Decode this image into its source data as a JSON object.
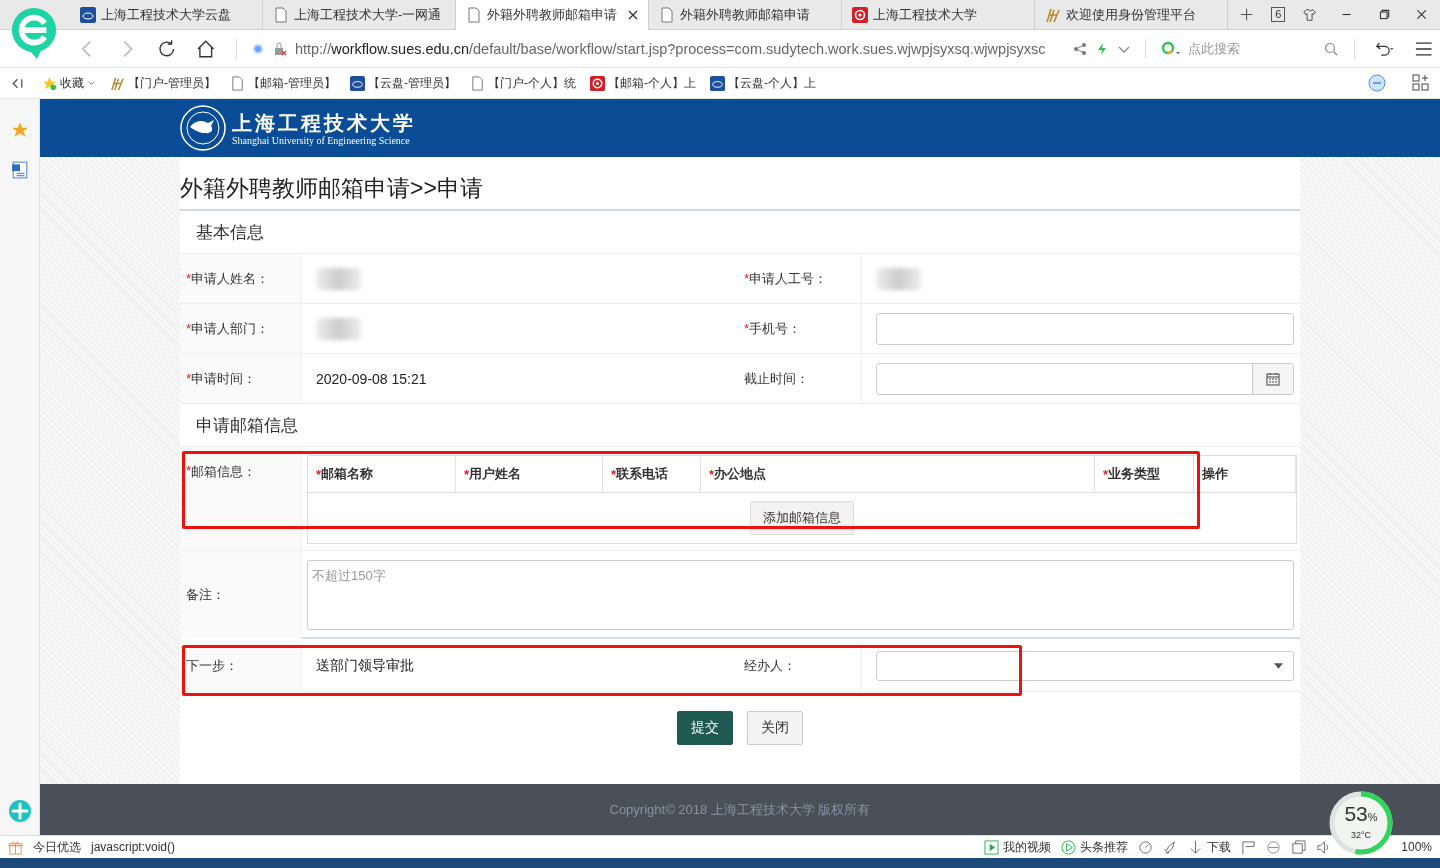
{
  "browser": {
    "tabs": [
      {
        "title": "上海工程技术大学云盘",
        "kind": "cloud",
        "selected": false
      },
      {
        "title": "上海工程技术大学-一网通",
        "kind": "page",
        "selected": false
      },
      {
        "title": "外籍外聘教师邮箱申请",
        "kind": "page",
        "selected": true
      },
      {
        "title": "外籍外聘教师邮箱申请",
        "kind": "page",
        "selected": false
      },
      {
        "title": "上海工程技术大学",
        "kind": "mail",
        "selected": false
      },
      {
        "title": "欢迎使用身份管理平台",
        "kind": "deer",
        "selected": false
      }
    ],
    "tab_count": "6",
    "url": {
      "scheme": "http://",
      "host": "workflow.sues.edu.cn",
      "path": "/default/base/workflow/start.jsp?process=com.sudytech.work.sues.wjwpjsyxsq.wjwpjsyxsc"
    },
    "search_placeholder": "点此搜索",
    "favorites": "收藏",
    "bookmarks": [
      {
        "label": "【门户-管理员】",
        "kind": "deer"
      },
      {
        "label": "【邮箱-管理员】",
        "kind": "page"
      },
      {
        "label": "【云盘-管理员】",
        "kind": "cloud"
      },
      {
        "label": "【门户-个人】统",
        "kind": "page"
      },
      {
        "label": "【邮箱-个人】上",
        "kind": "mail"
      },
      {
        "label": "【云盘-个人】上",
        "kind": "cloud"
      }
    ]
  },
  "page": {
    "logo": {
      "cn": "上海工程技术大学",
      "en": "Shanghai University of Engineering Science"
    },
    "title": "外籍外聘教师邮箱申请>>申请",
    "basic_section": "基本信息",
    "rows": [
      [
        {
          "mark": "*",
          "label": "申请人姓名：",
          "kind": "redacted"
        },
        {
          "mark": "*",
          "label": "申请人工号：",
          "kind": "redacted"
        }
      ],
      [
        {
          "mark": "*",
          "label": "申请人部门：",
          "kind": "redacted"
        },
        {
          "mark": "*",
          "label": "手机号：",
          "kind": "input"
        }
      ],
      [
        {
          "mark": "*",
          "label": "申请时间：",
          "kind": "text",
          "value": "2020-09-08 15:21"
        },
        {
          "label": "截止时间：",
          "kind": "date"
        }
      ]
    ],
    "mail_section": "申请邮箱信息",
    "mail": {
      "mark": "*",
      "label": "邮箱信息：",
      "highlighted": true,
      "columns": [
        {
          "mark": "*",
          "label": "邮箱名称"
        },
        {
          "mark": "*",
          "label": "用户姓名"
        },
        {
          "mark": "*",
          "label": "联系电话"
        },
        {
          "mark": "*",
          "label": "办公地点"
        },
        {
          "mark": "*",
          "label": "业务类型"
        },
        {
          "label": "操作"
        }
      ],
      "add_button": "添加邮箱信息"
    },
    "remarks": {
      "label": "备注：",
      "placeholder": "不超过150字"
    },
    "next": {
      "label": "下一步：",
      "value": "送部门领导审批",
      "handler_label": "经办人：",
      "highlighted": true
    },
    "buttons": [
      {
        "label": "提交",
        "kind": "primary"
      },
      {
        "label": "关闭",
        "kind": "default"
      }
    ],
    "footer": "Copyright© 2018 上海工程技术大学 版权所有"
  },
  "status_bar": {
    "left": [
      "今日优选",
      "javascript:void()"
    ],
    "video": "我的视频",
    "news": "头条推荐",
    "download": "下载",
    "zoom": "100%"
  },
  "gauge": {
    "value": "53",
    "unit": "%",
    "temp": "32°C",
    "level": 0.53
  }
}
